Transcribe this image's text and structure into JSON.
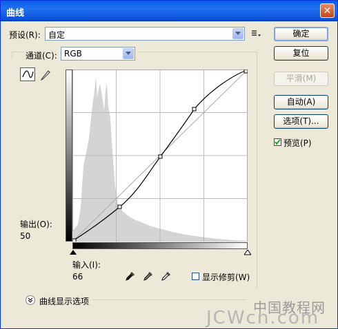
{
  "window": {
    "title": "曲线",
    "close": "✕"
  },
  "preset": {
    "label": "预设(R):",
    "value": "自定"
  },
  "channel": {
    "label": "通道(C):",
    "value": "RGB"
  },
  "buttons": {
    "ok": "确定",
    "reset": "复位",
    "smooth": "平滑(M)",
    "auto": "自动(A)",
    "options": "选项(T)..."
  },
  "preview": {
    "label": "预览(P)",
    "checked": true
  },
  "output": {
    "label": "输出(O):",
    "value": "50"
  },
  "input": {
    "label": "输入(I):",
    "value": "66"
  },
  "show_clipping": {
    "label": "显示修剪(W)",
    "checked": false
  },
  "curve_options": {
    "label": "曲线显示选项"
  },
  "curve": {
    "points": [
      [
        0,
        0
      ],
      [
        66,
        50
      ],
      [
        127,
        127
      ],
      [
        178,
        190
      ],
      [
        255,
        255
      ]
    ]
  },
  "watermark": {
    "top": "中国教程网",
    "bottom": "JCWcn.com"
  },
  "icons": [
    "close-icon",
    "preset-menu-icon",
    "curve-tool-icon",
    "pencil-icon",
    "black-eyedropper-icon",
    "gray-eyedropper-icon",
    "white-eyedropper-icon",
    "expand-icon"
  ]
}
